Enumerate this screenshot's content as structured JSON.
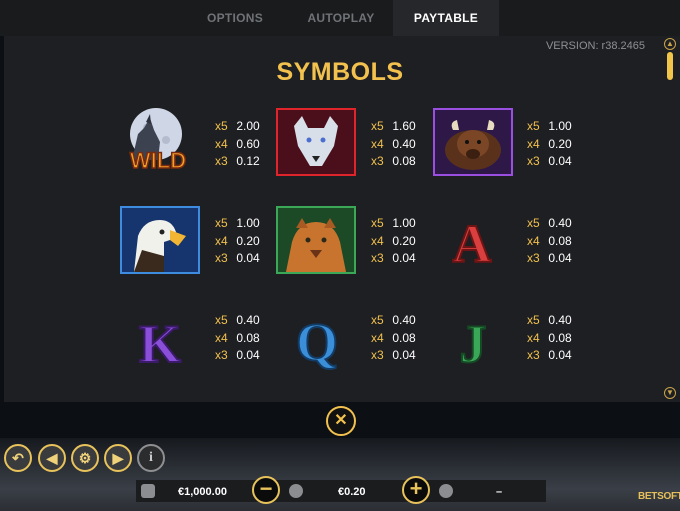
{
  "tabs": [
    {
      "label": "OPTIONS",
      "active": false
    },
    {
      "label": "AUTOPLAY",
      "active": false
    },
    {
      "label": "PAYTABLE",
      "active": true
    }
  ],
  "version": "VERSION: r38.2465",
  "title": "SYMBOLS",
  "symbols": [
    {
      "name": "wild-wolf",
      "logo_text": "WILD",
      "pays": [
        {
          "mult": "x5",
          "value": "2.00"
        },
        {
          "mult": "x4",
          "value": "0.60"
        },
        {
          "mult": "x3",
          "value": "0.12"
        }
      ]
    },
    {
      "name": "white-wolf",
      "pays": [
        {
          "mult": "x5",
          "value": "1.60"
        },
        {
          "mult": "x4",
          "value": "0.40"
        },
        {
          "mult": "x3",
          "value": "0.08"
        }
      ]
    },
    {
      "name": "bison",
      "pays": [
        {
          "mult": "x5",
          "value": "1.00"
        },
        {
          "mult": "x4",
          "value": "0.20"
        },
        {
          "mult": "x3",
          "value": "0.04"
        }
      ]
    },
    {
      "name": "eagle",
      "pays": [
        {
          "mult": "x5",
          "value": "1.00"
        },
        {
          "mult": "x4",
          "value": "0.20"
        },
        {
          "mult": "x3",
          "value": "0.04"
        }
      ]
    },
    {
      "name": "cougar",
      "pays": [
        {
          "mult": "x5",
          "value": "1.00"
        },
        {
          "mult": "x4",
          "value": "0.20"
        },
        {
          "mult": "x3",
          "value": "0.04"
        }
      ]
    },
    {
      "name": "letter-a",
      "glyph": "A",
      "color": "#d93f3f",
      "pays": [
        {
          "mult": "x5",
          "value": "0.40"
        },
        {
          "mult": "x4",
          "value": "0.08"
        },
        {
          "mult": "x3",
          "value": "0.04"
        }
      ]
    },
    {
      "name": "letter-k",
      "glyph": "K",
      "color": "#8a4fd8",
      "pays": [
        {
          "mult": "x5",
          "value": "0.40"
        },
        {
          "mult": "x4",
          "value": "0.08"
        },
        {
          "mult": "x3",
          "value": "0.04"
        }
      ]
    },
    {
      "name": "letter-q",
      "glyph": "Q",
      "color": "#3b8fd8",
      "pays": [
        {
          "mult": "x5",
          "value": "0.40"
        },
        {
          "mult": "x4",
          "value": "0.08"
        },
        {
          "mult": "x3",
          "value": "0.04"
        }
      ]
    },
    {
      "name": "letter-j",
      "glyph": "J",
      "color": "#3aa657",
      "pays": [
        {
          "mult": "x5",
          "value": "0.40"
        },
        {
          "mult": "x4",
          "value": "0.08"
        },
        {
          "mult": "x3",
          "value": "0.04"
        }
      ]
    }
  ],
  "bottom": {
    "balance": "€1,000.00",
    "bet": "€0.20",
    "win": "–",
    "logo": "BETSOFT"
  },
  "colors": {
    "accent": "#f2c14e",
    "panel": "#1e1f22"
  },
  "icons": [
    "back-icon",
    "prev-icon",
    "settings-icon",
    "next-icon",
    "info-icon",
    "close-icon",
    "wallet-icon",
    "minus-icon",
    "coins-icon",
    "plus-icon",
    "award-icon"
  ]
}
